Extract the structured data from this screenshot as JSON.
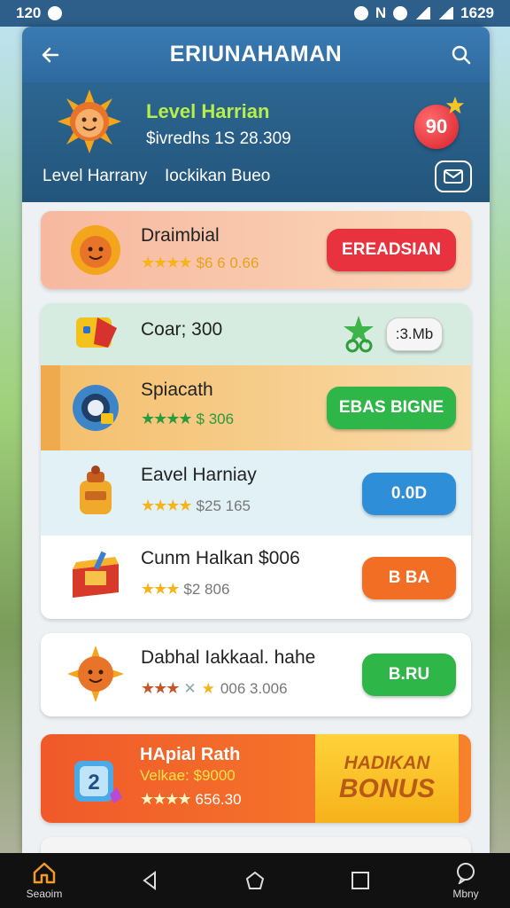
{
  "status_bar": {
    "time": "120",
    "right_time": "1629",
    "carrier": "N"
  },
  "app_bar": {
    "title": "ERIUNAHAMAN"
  },
  "banner": {
    "level_title": "Level Harrian",
    "subtitle": "$ivredhs 1S 28.309",
    "label_left": "Level Harrany",
    "label_right": "Iockikan  Bueo",
    "badge": "90"
  },
  "cards": [
    {
      "name": "Draimbial",
      "meta": "$6  6 0.66",
      "button": "EREADSIAN",
      "button_color": "#e8323d",
      "bg": "#f6c4a6"
    },
    {
      "name": "Coar; 300",
      "meta": "",
      "button": ":3.Mb",
      "button_color": "#ffffff",
      "bg": "#d6ece1"
    },
    {
      "name": "Spiacath",
      "meta": "$ 306",
      "button": "EBAS BIGNE",
      "button_color": "#2fb648",
      "bg": "#f7cf92"
    },
    {
      "name": "Eavel Harniay",
      "meta": "$25 165",
      "button": "0.0D",
      "button_color": "#2f8ed8",
      "bg": "#e2f1f6"
    },
    {
      "name": "Cunm Halkan  $006",
      "meta": "$2 806",
      "button": "B BA",
      "button_color": "#f26e24",
      "bg": "#ffffff"
    },
    {
      "name": "Dabhal  Iakkaal. hahe",
      "meta": "006  3.006",
      "button": "B.RU",
      "button_color": "#2fb648",
      "bg": "#ffffff"
    },
    {
      "name": "HApial Rath",
      "meta_line1": "Velkae: $9000",
      "meta": "656.30",
      "bonus_line1": "HADIKAN",
      "bonus_line2": "BONUS",
      "bg": "#f4682a"
    }
  ],
  "nav": {
    "home_label": "Seaoim",
    "more_label": "Mbny"
  }
}
